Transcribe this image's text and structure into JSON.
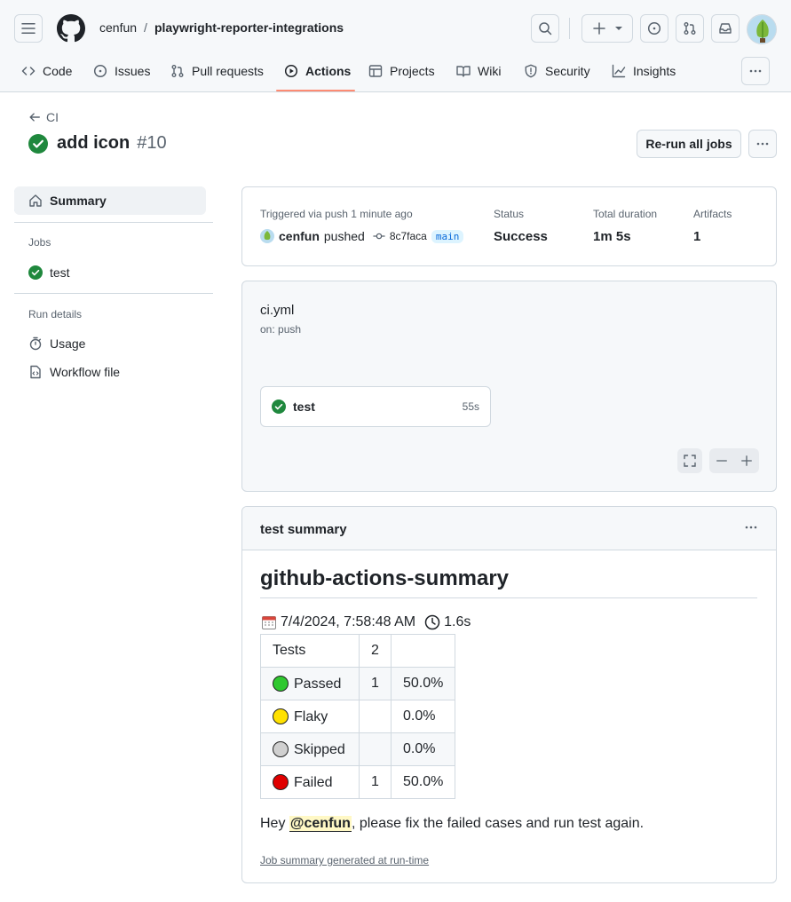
{
  "header": {
    "owner": "cenfun",
    "separator": "/",
    "repo": "playwright-reporter-integrations"
  },
  "nav": {
    "tabs": [
      {
        "label": "Code",
        "icon": "code-icon"
      },
      {
        "label": "Issues",
        "icon": "issue-icon"
      },
      {
        "label": "Pull requests",
        "icon": "git-pull-request-icon"
      },
      {
        "label": "Actions",
        "icon": "play-icon",
        "active": true
      },
      {
        "label": "Projects",
        "icon": "table-icon"
      },
      {
        "label": "Wiki",
        "icon": "book-icon"
      },
      {
        "label": "Security",
        "icon": "shield-icon"
      },
      {
        "label": "Insights",
        "icon": "graph-icon"
      }
    ]
  },
  "run": {
    "back_label": "CI",
    "title": "add icon",
    "number": "#10",
    "rerun_label": "Re-run all jobs"
  },
  "sidebar": {
    "summary_label": "Summary",
    "jobs_heading": "Jobs",
    "job_label": "test",
    "run_details_heading": "Run details",
    "usage_label": "Usage",
    "workflow_file_label": "Workflow file"
  },
  "info": {
    "trigger": "Triggered via push 1 minute ago",
    "user": "cenfun",
    "pushed": "pushed",
    "commit": "8c7faca",
    "branch": "main",
    "status_label": "Status",
    "status_value": "Success",
    "duration_label": "Total duration",
    "duration_value": "1m 5s",
    "artifacts_label": "Artifacts",
    "artifacts_value": "1"
  },
  "workflow": {
    "file": "ci.yml",
    "trigger": "on: push",
    "job_name": "test",
    "job_duration": "55s"
  },
  "test_summary": {
    "header": "test summary",
    "heading": "github-actions-summary",
    "date": "7/4/2024, 7:58:48 AM",
    "duration": "1.6s",
    "table": {
      "total_label": "Tests",
      "total_value": "2",
      "rows": [
        {
          "label": "Passed",
          "count": "1",
          "percent": "50.0%",
          "color": "#2fc82f"
        },
        {
          "label": "Flaky",
          "count": "",
          "percent": "0.0%",
          "color": "#ffe100"
        },
        {
          "label": "Skipped",
          "count": "",
          "percent": "0.0%",
          "color": "#d0d0d0"
        },
        {
          "label": "Failed",
          "count": "1",
          "percent": "50.0%",
          "color": "#e00000"
        }
      ]
    },
    "message_prefix": "Hey",
    "mention": "@cenfun",
    "message_suffix": ", please fix the failed cases and run test again.",
    "footer_link": "Job summary generated at run-time"
  },
  "colors": {
    "success": "#1f883d",
    "accent": "#0969da",
    "tab_underline": "#fd8c73",
    "border": "#d1d9e0"
  }
}
